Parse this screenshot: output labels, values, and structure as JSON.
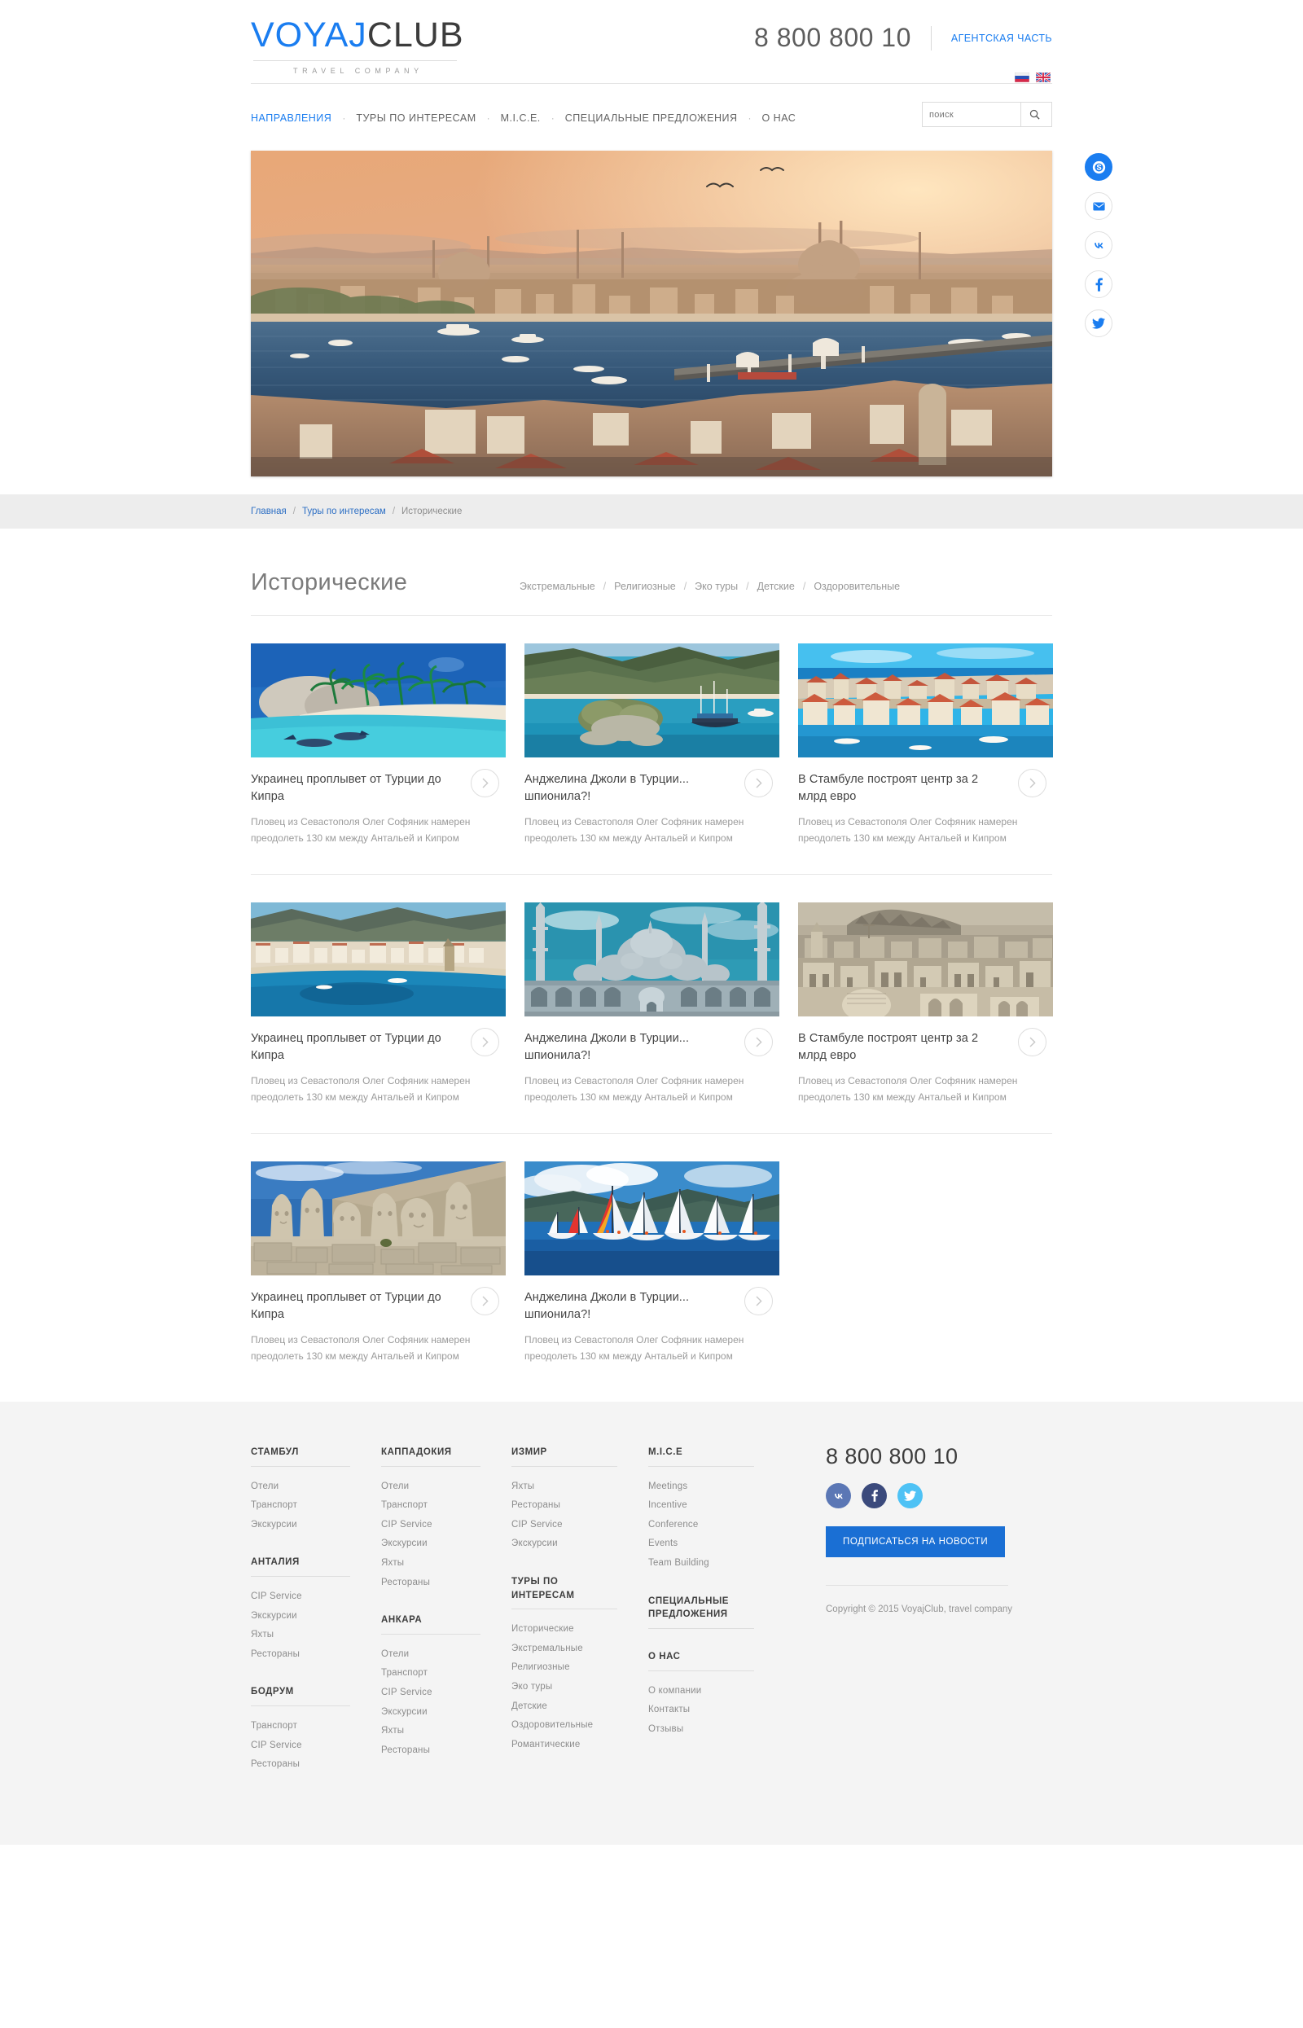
{
  "header": {
    "logo": {
      "part1": "VOYAJ",
      "part2": "CLUB",
      "tagline": "TRAVEL COMPANY"
    },
    "phone": "8 800 800 10",
    "agent_link": "АГЕНТСКАЯ ЧАСТЬ",
    "nav": [
      {
        "label": "НАПРАВЛЕНИЯ",
        "active": true
      },
      {
        "label": "ТУРЫ ПО ИНТЕРЕСАМ",
        "active": false
      },
      {
        "label": "M.I.C.E.",
        "active": false
      },
      {
        "label": "СПЕЦИАЛЬНЫЕ ПРЕДЛОЖЕНИЯ",
        "active": false
      },
      {
        "label": "О НАС",
        "active": false
      }
    ],
    "nav_separator": "·",
    "languages": [
      {
        "name": "ru-flag-icon"
      },
      {
        "name": "en-flag-icon"
      }
    ],
    "search": {
      "placeholder": "поиск",
      "value": "",
      "icon": "search-icon"
    }
  },
  "social_rail": [
    {
      "name": "skype-icon",
      "label": "Skype",
      "filled": true
    },
    {
      "name": "mail-icon",
      "label": "E-mail",
      "filled": false
    },
    {
      "name": "vk-icon",
      "label": "VKontakte",
      "filled": false
    },
    {
      "name": "facebook-icon",
      "label": "Facebook",
      "filled": false
    },
    {
      "name": "twitter-icon",
      "label": "Twitter",
      "filled": false
    }
  ],
  "breadcrumb": {
    "items": [
      "Главная",
      "Туры по интересам"
    ],
    "current": "Исторические",
    "separator": "/"
  },
  "main": {
    "title": "Исторические",
    "subnav": [
      "Экстремальные",
      "Религиозные",
      "Эко туры",
      "Детские",
      "Оздоровительные"
    ],
    "subnav_separator": "/",
    "card_description": "Пловец из Севастополя Олег Софяник намерен преодолеть 130 км между Антальей и Кипром",
    "arrow_icon": "chevron-right-icon",
    "rows": [
      {
        "cards": [
          {
            "title": "Украинец проплывет от Турции до Кипра",
            "image": "beach-snorkel-photo"
          },
          {
            "title": "Анджелина Джоли в Турции... шпионила?!",
            "image": "bay-gulet-photo"
          },
          {
            "title": "В Стамбуле построят центр за 2 млрд евро",
            "image": "coastal-city-photo"
          }
        ]
      },
      {
        "cards": [
          {
            "title": "Украинец проплывет от Турции до Кипра",
            "image": "alanya-bay-photo"
          },
          {
            "title": "Анджелина Джоли в Турции... шпионила?!",
            "image": "blue-mosque-photo"
          },
          {
            "title": "В Стамбуле построят центр за 2 млрд евро",
            "image": "mardin-old-town-photo"
          }
        ]
      },
      {
        "cards": [
          {
            "title": "Украинец проплывет от Турции до Кипра",
            "image": "nemrut-statues-photo"
          },
          {
            "title": "Анджелина Джоли в Турции... шпионила?!",
            "image": "sailing-regatta-photo"
          }
        ]
      }
    ]
  },
  "footer": {
    "columns": [
      {
        "groups": [
          {
            "head": "СТАМБУЛ",
            "links": [
              "Отели",
              "Транспорт",
              "Экскурсии"
            ]
          },
          {
            "head": "АНТАЛИЯ",
            "links": [
              "CIP Service",
              "Экскурсии",
              "Яхты",
              "Рестораны"
            ]
          },
          {
            "head": "БОДРУМ",
            "links": [
              "Транспорт",
              "CIP Service",
              "Рестораны"
            ]
          }
        ]
      },
      {
        "groups": [
          {
            "head": "КАППАДОКИЯ",
            "links": [
              "Отели",
              "Транспорт",
              "CIP Service",
              "Экскурсии",
              "Яхты",
              "Рестораны"
            ]
          },
          {
            "head": "АНКАРА",
            "links": [
              "Отели",
              "Транспорт",
              "CIP Service",
              "Экскурсии",
              "Яхты",
              "Рестораны"
            ]
          }
        ]
      },
      {
        "groups": [
          {
            "head": "ИЗМИР",
            "links": [
              "Яхты",
              "Рестораны",
              "CIP Service",
              "Экскурсии"
            ]
          },
          {
            "head": "ТУРЫ ПО ИНТЕРЕСАМ",
            "links": [
              "Исторические",
              "Экстремальные",
              "Религиозные",
              "Эко туры",
              "Детские",
              "Оздоровительные",
              "Романтические"
            ]
          }
        ]
      },
      {
        "groups": [
          {
            "head": "M.I.C.E",
            "links": [
              "Meetings",
              "Incentive",
              "Conference",
              "Events",
              "Team Building"
            ]
          },
          {
            "head": "СПЕЦИАЛЬНЫЕ ПРЕДЛОЖЕНИЯ",
            "links": []
          },
          {
            "head": "О НАС",
            "links": [
              "О компании",
              "Контакты",
              "Отзывы"
            ]
          }
        ]
      }
    ],
    "phone": "8 800 800 10",
    "social": [
      {
        "name": "vk-icon",
        "class": "vk"
      },
      {
        "name": "facebook-icon",
        "class": "fb"
      },
      {
        "name": "twitter-icon",
        "class": "tw"
      }
    ],
    "subscribe_label": "ПОДПИСАТЬСЯ НА НОВОСТИ",
    "copyright": "Copyright © 2015 VoyajClub, travel company"
  },
  "colors": {
    "accent": "#1a7df0",
    "accent_dark": "#1a6fd4",
    "text": "#4c4c4c",
    "muted": "#9b9b9b",
    "footer_bg": "#f4f4f4",
    "crumb_bg": "#ededed"
  }
}
